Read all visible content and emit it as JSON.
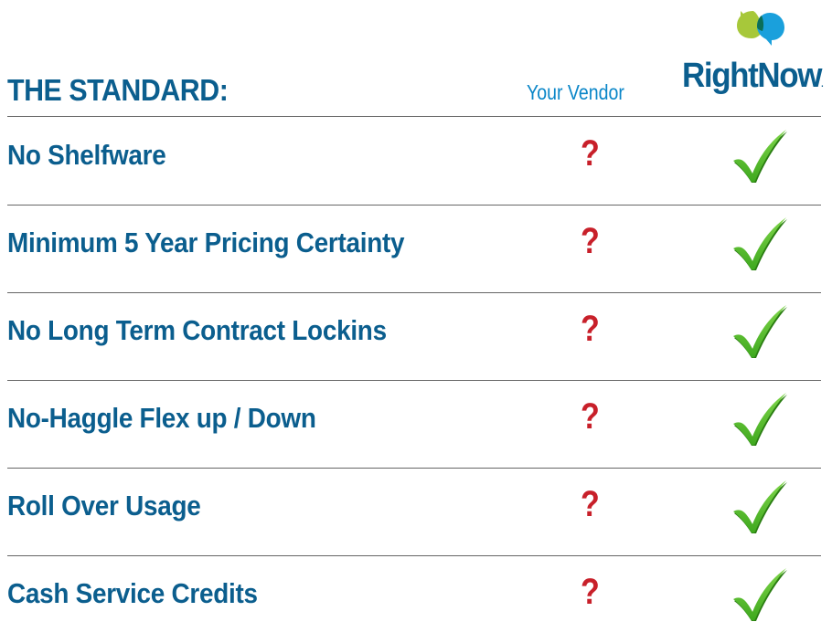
{
  "header": {
    "title": "THE STANDARD:",
    "vendor_column": "Your Vendor",
    "brand_name": "RightNow",
    "brand_suffix": "."
  },
  "rows": [
    {
      "label": "No Shelfware",
      "vendor_value": "?",
      "brand_value": "check-icon"
    },
    {
      "label": "Minimum 5 Year Pricing Certainty",
      "vendor_value": "?",
      "brand_value": "check-icon"
    },
    {
      "label": "No Long Term Contract Lockins",
      "vendor_value": "?",
      "brand_value": "check-icon"
    },
    {
      "label": "No-Haggle Flex up / Down",
      "vendor_value": "?",
      "brand_value": "check-icon"
    },
    {
      "label": "Roll Over Usage",
      "vendor_value": "?",
      "brand_value": "check-icon"
    },
    {
      "label": "Cash Service Credits",
      "vendor_value": "?",
      "brand_value": "check-icon"
    }
  ],
  "colors": {
    "heading": "#0b5e8e",
    "vendor_label": "#0a86c8",
    "question": "#c8202a",
    "check": "#3ea81e",
    "logo_green": "#a7c83a",
    "logo_blue": "#1aa0dc"
  }
}
